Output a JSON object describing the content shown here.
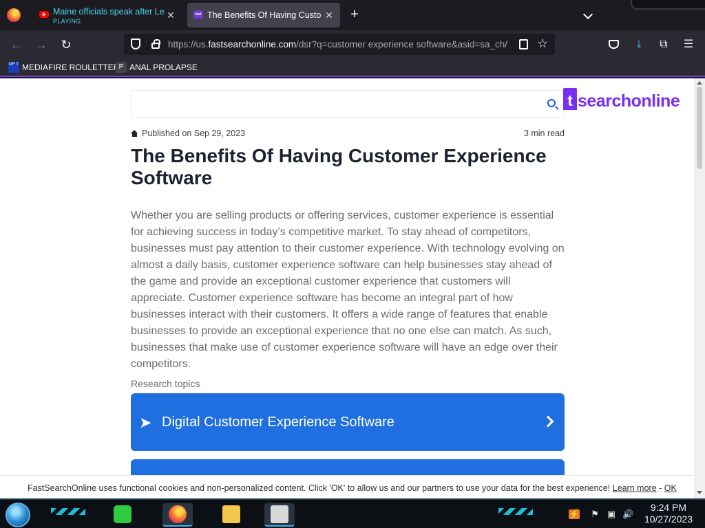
{
  "browser": {
    "tabs": [
      {
        "title": "Maine officials speak after Lewiston",
        "status": "PLAYING",
        "favicon": "youtube-icon"
      },
      {
        "title": "The Benefits Of Having Customer Experience Software",
        "favicon": "fastsearch-icon",
        "favicon_text": "fast"
      }
    ],
    "url": {
      "prefix": "https://us.",
      "host": "fastsearchonline.com",
      "path": "/dsr?q=customer experience software&asid=sa_ch/"
    },
    "bookmarks": [
      {
        "label": "MEDIAFIRE ROULETTER",
        "icon_text": "MF T"
      },
      {
        "label": "ANAL PROLAPSE",
        "icon_text": "P"
      }
    ]
  },
  "page": {
    "search": {
      "placeholder": ""
    },
    "logo": {
      "mark": "t",
      "text": "searchonline"
    },
    "meta": {
      "published": "Published on Sep 29, 2023",
      "read_time": "3 min read"
    },
    "headline": "The Benefits Of Having Customer Experience Software",
    "body": "Whether you are selling products or offering services, customer experience is essential for achieving success in today’s competitive market. To stay ahead of competitors, businesses must pay attention to their customer experience. With technology evolving on almost a daily basis, customer experience software can help businesses stay ahead of the game and provide an exceptional customer experience that customers will appreciate. Customer experience software has become an integral part of how businesses interact with their customers. It offers a wide range of features that enable businesses to provide an exceptional experience that no one else can match. As such, businesses that make use of customer experience software will have an edge over their competitors.",
    "research_label": "Research topics",
    "topics": [
      {
        "label": "Digital Customer Experience Software"
      },
      {
        "label": ""
      }
    ],
    "cookie": {
      "message": "FastSearchOnline uses functional cookies and non-personalized content. Click 'OK' to allow us and our partners to use your data for the best experience!",
      "learn_more": "Learn more",
      "separator": "-",
      "ok": "OK"
    }
  },
  "taskbar": {
    "time": "9:24 PM",
    "date": "10/27/2023"
  },
  "colors": {
    "accent": "#7a2ff0",
    "topic_card": "#1f6fe0",
    "tab_playing": "#4fd4f0"
  }
}
